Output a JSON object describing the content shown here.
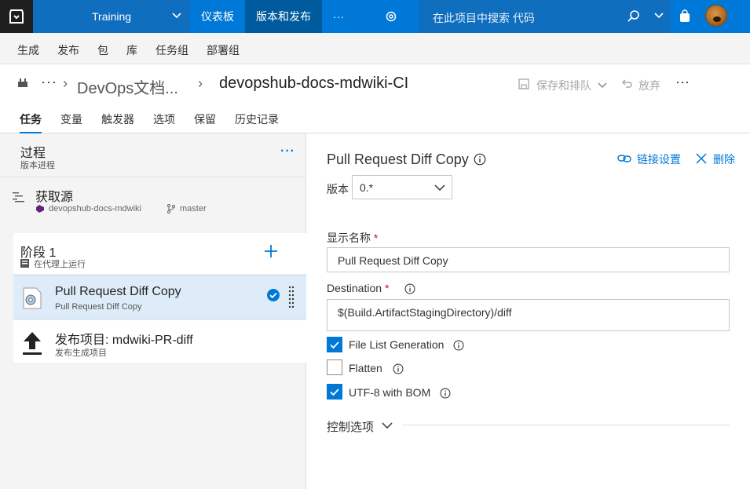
{
  "topnav": {
    "project": "Training",
    "items": [
      "仪表板",
      "版本和发布",
      "···"
    ],
    "search_placeholder": "在此项目中搜索 代码"
  },
  "subnav": {
    "items": [
      "生成",
      "发布",
      "包",
      "库",
      "任务组",
      "部署组"
    ]
  },
  "breadcrumb": {
    "ellipsis": "···",
    "parent": "DevOps文档...",
    "current": "devopshub-docs-mdwiki-CI",
    "save_queue": "保存和排队",
    "discard": "放弃",
    "more": "···"
  },
  "tabs": [
    "任务",
    "变量",
    "触发器",
    "选项",
    "保留",
    "历史记录"
  ],
  "process": {
    "title": "过程",
    "subtitle": "版本进程",
    "more": "···",
    "source": {
      "title": "获取源",
      "repo": "devopshub-docs-mdwiki",
      "branch": "master"
    },
    "phase": {
      "title": "阶段 1",
      "subtitle": "在代理上运行"
    },
    "tasks": [
      {
        "title": "Pull Request Diff Copy",
        "subtitle": "Pull Request Diff Copy"
      },
      {
        "title": "发布项目: mdwiki-PR-diff",
        "subtitle": "发布生成项目"
      }
    ]
  },
  "detail": {
    "title": "Pull Request Diff Copy",
    "link_settings": "链接设置",
    "delete": "删除",
    "version_label": "版本",
    "version_value": "0.*",
    "display_name_label": "显示名称",
    "display_name_value": "Pull Request Diff Copy",
    "destination_label": "Destination",
    "destination_value": "$(Build.ArtifactStagingDirectory)/diff",
    "required_mark": "*",
    "checkboxes": [
      {
        "label": "File List Generation",
        "checked": true
      },
      {
        "label": "Flatten",
        "checked": false
      },
      {
        "label": "UTF-8 with BOM",
        "checked": true
      }
    ],
    "control_options": "控制选项"
  },
  "colors": {
    "accent": "#0078d7",
    "nav_bg": "#0078d7",
    "logo_bg": "#1e1e1e"
  }
}
